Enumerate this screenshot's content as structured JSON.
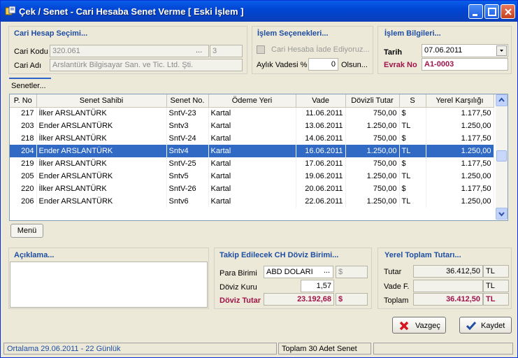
{
  "window": {
    "title": "Çek / Senet - Cari Hesaba Senet Verme   [ Eski İşlem ]"
  },
  "cari": {
    "heading": "Cari Hesap Seçimi...",
    "kod_label": "Cari Kodu",
    "kod_value": "320.061",
    "kod_btn": "...",
    "kod_num": "3",
    "adi_label": "Cari Adı",
    "adi_value": "Arslantürk Bilgisayar San. ve Tic. Ltd. Şti."
  },
  "islem_secenek": {
    "heading": "İşlem Seçenekleri...",
    "iade_label": "Cari Hesaba İade Ediyoruz...",
    "vade_label": "Aylık Vadesi %",
    "vade_value": "0",
    "olsun_label": "Olsun..."
  },
  "islem_bilgi": {
    "heading": "İşlem Bilgileri...",
    "tarih_label": "Tarih",
    "tarih_value": "07.06.2011",
    "evrak_label": "Evrak No",
    "evrak_value": "A1-0003"
  },
  "tab": {
    "label": "Senetler..."
  },
  "grid": {
    "columns": [
      "P. No",
      "Senet Sahibi",
      "Senet No.",
      "Ödeme Yeri",
      "Vade",
      "Dövizli Tutar",
      "S",
      "Yerel Karşılığı"
    ],
    "rows": [
      [
        "217",
        "İlker ARSLANTÜRK",
        "SntV-23",
        "Kartal",
        "11.06.2011",
        "750,00",
        "$",
        "1.177,50"
      ],
      [
        "203",
        "Ender ARSLANTÜRK",
        "Sntv3",
        "Kartal",
        "13.06.2011",
        "1.250,00",
        "TL",
        "1.250,00"
      ],
      [
        "218",
        "İlker ARSLANTÜRK",
        "SntV-24",
        "Kartal",
        "14.06.2011",
        "750,00",
        "$",
        "1.177,50"
      ],
      [
        "204",
        "Ender ARSLANTÜRK",
        "Sntv4",
        "Kartal",
        "16.06.2011",
        "1.250,00",
        "TL",
        "1.250,00"
      ],
      [
        "219",
        "İlker ARSLANTÜRK",
        "SntV-25",
        "Kartal",
        "17.06.2011",
        "750,00",
        "$",
        "1.177,50"
      ],
      [
        "205",
        "Ender ARSLANTÜRK",
        "Sntv5",
        "Kartal",
        "19.06.2011",
        "1.250,00",
        "TL",
        "1.250,00"
      ],
      [
        "220",
        "İlker ARSLANTÜRK",
        "SntV-26",
        "Kartal",
        "20.06.2011",
        "750,00",
        "$",
        "1.177,50"
      ],
      [
        "206",
        "Ender ARSLANTÜRK",
        "Sntv6",
        "Kartal",
        "22.06.2011",
        "1.250,00",
        "TL",
        "1.250,00"
      ]
    ],
    "selected_index": 3
  },
  "menu_button": "Menü",
  "aciklama": {
    "heading": "Açıklama..."
  },
  "doviz": {
    "heading": "Takip Edilecek CH Döviz Birimi...",
    "para_label": "Para Birimi",
    "para_value": "ABD DOLARI",
    "para_btn": "...",
    "para_symbol": "$",
    "kur_label": "Döviz Kuru",
    "kur_value": "1,57",
    "tutar_label": "Döviz Tutar",
    "tutar_value": "23.192,68",
    "tutar_symbol": "$"
  },
  "yerel": {
    "heading": "Yerel Toplam Tutarı...",
    "tutar_label": "Tutar",
    "tutar_value": "36.412,50",
    "tutar_cur": "TL",
    "vade_label": "Vade F.",
    "vade_value": "",
    "vade_cur": "TL",
    "toplam_label": "Toplam",
    "toplam_value": "36.412,50",
    "toplam_cur": "TL"
  },
  "buttons": {
    "vazgec": "Vazgeç",
    "kaydet": "Kaydet"
  },
  "status": {
    "ortalama": "Ortalama 29.06.2011 - 22 Günlük",
    "toplam": "Toplam 30 Adet Senet",
    "empty": ""
  },
  "colors": {
    "heading": "#1f4ea3",
    "accent_red": "#a0144a",
    "selection": "#316ac5"
  }
}
